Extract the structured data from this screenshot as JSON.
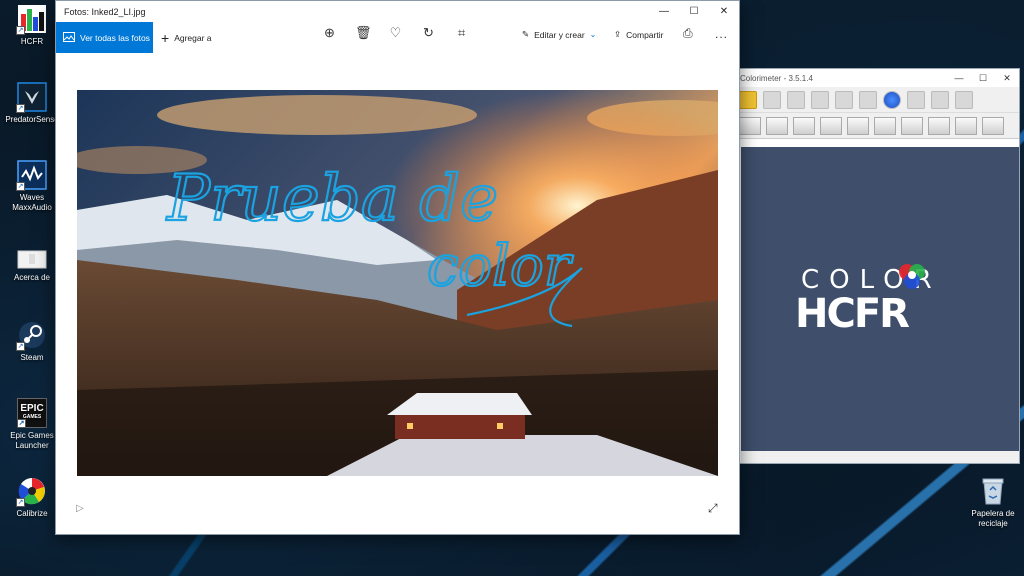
{
  "desktop": {
    "icons": [
      {
        "label": "HCFR",
        "icon": "hcfr-app-icon"
      },
      {
        "label": "PredatorSense",
        "icon": "predator-icon"
      },
      {
        "label": "Waves MaxxAudio",
        "icon": "waves-icon"
      },
      {
        "label": "Acerca de",
        "icon": "about-icon"
      },
      {
        "label": "Steam",
        "icon": "steam-icon"
      },
      {
        "label": "Epic Games Launcher",
        "icon": "epic-games-icon"
      },
      {
        "label": "Calibrize",
        "icon": "calibrize-icon"
      }
    ],
    "epic_icon_text": "EPIC",
    "epic_icon_subtext": "GAMES",
    "recycle_bin": {
      "label": "Papelera de reciclaje",
      "icon": "recycle-bin-icon"
    }
  },
  "photos_window": {
    "title": "Fotos: Inked2_LI.jpg",
    "view_all_label": "Ver todas las fotos",
    "add_to_label": "Agregar a",
    "edit_create_label": "Editar y crear",
    "share_label": "Compartir",
    "more_label": "...",
    "toolbar_icons": [
      "zoom-icon",
      "delete-icon",
      "favorite-icon",
      "rotate-icon",
      "crop-icon",
      "print-icon"
    ],
    "image": {
      "handwritten_line_1": "Prueba de",
      "handwritten_line_2": "color"
    }
  },
  "colorimeter_window": {
    "title": "Colorimeter - 3.5.1.4",
    "logo_top": "COLOR",
    "logo_bottom": "HCFR",
    "accent_colors": {
      "red": "#e8262c",
      "green": "#29b34a",
      "blue": "#1f4fd8"
    }
  },
  "window_controls": {
    "minimize": "—",
    "maximize": "☐",
    "close": "✕"
  }
}
